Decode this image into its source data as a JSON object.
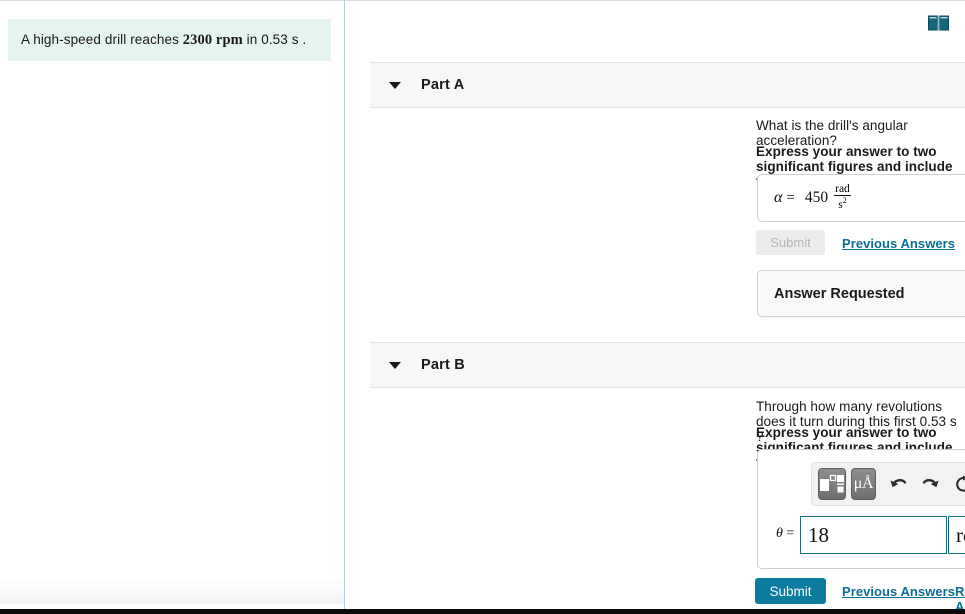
{
  "window": {
    "book_icon": "open-book-icon",
    "book_icon_color": "#16667d"
  },
  "left_panel": {
    "question_prefix": "A high-speed drill reaches ",
    "question_unit": "2300 rpm",
    "question_suffix": " in 0.53 s .",
    "question_full": "A high-speed drill reaches 2300 rpm in 0.53 s .",
    "background_color": "#e5f3f1"
  },
  "parts": [
    {
      "id": "part-a",
      "title": "Part A",
      "caret": "caret-down-icon",
      "prompt": "What is the drill's angular acceleration?",
      "instruction": "Express your answer to two significant figures and include the appropriate units.",
      "answer": {
        "variable": "α",
        "equals": "=",
        "value": "450",
        "unit_numerator": "rad",
        "unit_denominator": "s",
        "unit_denominator_exp": "2",
        "unit_text": "rad/s^2"
      },
      "submit_label": "Submit",
      "submit_enabled": false,
      "previous_answers_label": "Previous Answers",
      "status_box": "Answer Requested"
    },
    {
      "id": "part-b",
      "title": "Part B",
      "caret": "caret-down-icon",
      "prompt": "Through how many revolutions does it turn during this first 0.53 s ?",
      "instruction": "Express your answer to two significant figures and include the appropriate units.",
      "toolbar": [
        {
          "name": "template-layout-icon",
          "label": "",
          "active": true
        },
        {
          "name": "units-symbols-icon",
          "label": "μÅ",
          "active": true
        },
        {
          "name": "undo-icon",
          "label": "↶",
          "active": false
        },
        {
          "name": "redo-icon",
          "label": "↷",
          "active": false
        },
        {
          "name": "reset-icon",
          "label": "↺",
          "active": false
        },
        {
          "name": "keyboard-icon",
          "label": "",
          "active": false
        },
        {
          "name": "help-icon",
          "label": "?",
          "active": false
        }
      ],
      "answer": {
        "variable": "θ",
        "equals": "=",
        "value": "18",
        "unit": "rev"
      },
      "submit_label": "Submit",
      "submit_enabled": true,
      "previous_answers_label": "Previous Answers",
      "request_answer_label": "Request Answer"
    }
  ],
  "colors": {
    "accent_teal": "#0b7b9e",
    "link_blue": "#0b6f96",
    "field_border": "#1a6e87",
    "header_bg": "#f7f7f7"
  }
}
